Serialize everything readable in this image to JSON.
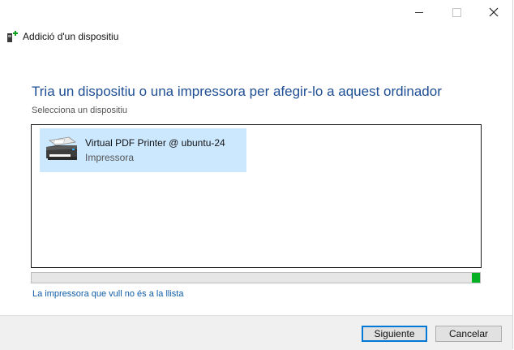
{
  "window": {
    "title": "Addició d'un dispositiu"
  },
  "page": {
    "heading": "Tria un dispositiu o una impressora per afegir-lo a aquest ordinador",
    "subheading": "Selecciona un dispositiu"
  },
  "devices": [
    {
      "name": "Virtual PDF Printer @ ubuntu-24",
      "type": "Impressora",
      "icon": "printer-icon",
      "selected": true
    }
  ],
  "progress": {
    "fraction": 0.018,
    "color": "#06b025"
  },
  "link": {
    "label": "La impressora que vull no és a la llista"
  },
  "footer": {
    "next_label": "Siguiente",
    "cancel_label": "Cancelar"
  },
  "colors": {
    "heading": "#1e4e94",
    "link": "#0f5da8",
    "selection": "#cce8ff",
    "default_button_border": "#0078d7"
  }
}
